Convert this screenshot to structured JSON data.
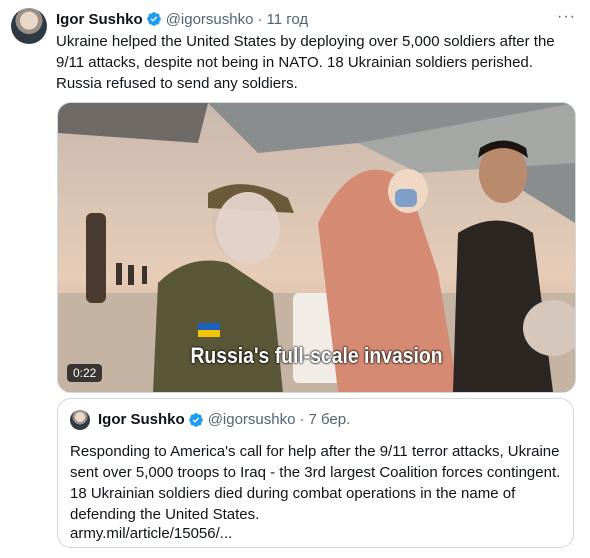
{
  "tweet": {
    "author_name": "Igor Sushko",
    "handle": "@igorsushko",
    "separator": "·",
    "time": "11 год",
    "more_label": "···",
    "text": "Ukraine helped the United States by deploying over 5,000 soldiers after the 9/11 attacks, despite not being in NATO. 18 Ukrainian soldiers perished. Russia refused to send any soldiers.",
    "video": {
      "caption": "Russia's full-scale invasion",
      "duration": "0:22"
    }
  },
  "quoted_tweet": {
    "author_name": "Igor Sushko",
    "handle": "@igorsushko",
    "separator": "·",
    "time": "7 бер.",
    "text": "Responding to America's call for help after the 9/11 terror attacks, Ukraine sent over 5,000 troops to Iraq - the 3rd largest Coalition forces contingent. 18 Ukrainian soldiers died during combat operations in the name of defending the United States.",
    "link": "army.mil/article/15056/..."
  },
  "colors": {
    "verified_blue": "#1d9bf0",
    "secondary_text": "#536471",
    "border": "#cfd9de"
  }
}
